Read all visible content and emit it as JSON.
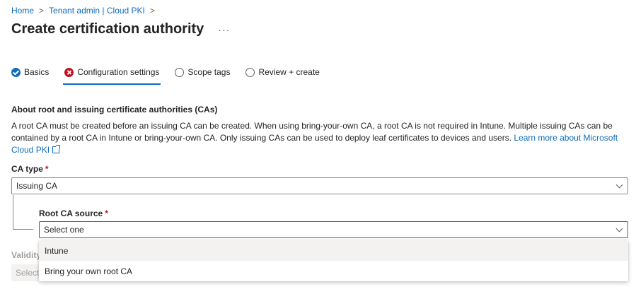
{
  "breadcrumb": {
    "items": [
      "Home",
      "Tenant admin | Cloud PKI"
    ],
    "separator": ">"
  },
  "page": {
    "title": "Create certification authority",
    "more": "···"
  },
  "tabs": [
    {
      "label": "Basics",
      "status": "complete"
    },
    {
      "label": "Configuration settings",
      "status": "error"
    },
    {
      "label": "Scope tags",
      "status": "empty"
    },
    {
      "label": "Review + create",
      "status": "empty"
    }
  ],
  "section": {
    "heading": "About root and issuing certificate authorities (CAs)",
    "description": "A root CA must be created before an issuing CA can be created. When using bring-your-own CA, a root CA is not required in Intune. Multiple issuing CAs can be contained by a root CA in Intune or bring-your-own CA. Only issuing CAs can be used to deploy leaf certificates to devices and users. ",
    "link": "Learn more about Microsoft Cloud PKI"
  },
  "ca_type": {
    "label": "CA type",
    "required": "*",
    "value": "Issuing CA"
  },
  "root_ca_source": {
    "label": "Root CA source",
    "required": "*",
    "placeholder": "Select one",
    "options": [
      "Intune",
      "Bring your own root CA"
    ]
  },
  "validity": {
    "label": "Validity",
    "value": "Select"
  },
  "colors": {
    "accent": "#0f6cbd",
    "error": "#c50f1f"
  }
}
